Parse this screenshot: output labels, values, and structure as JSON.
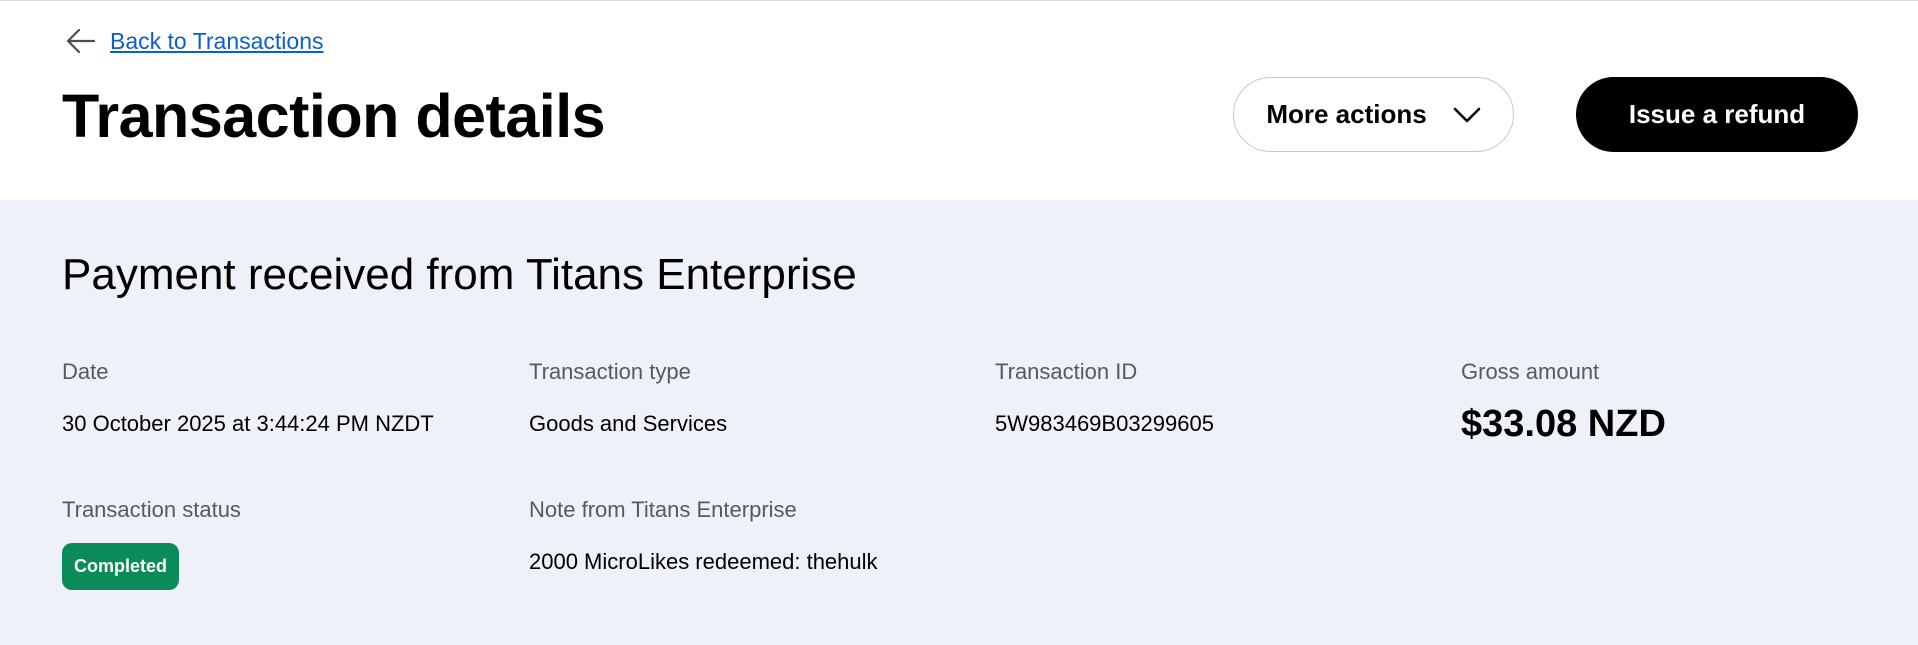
{
  "header": {
    "back_label": "Back to Transactions",
    "title": "Transaction details",
    "more_actions_label": "More actions",
    "refund_label": "Issue a refund"
  },
  "transaction": {
    "heading": "Payment received from Titans Enterprise",
    "date_label": "Date",
    "date_value": "30 October 2025 at 3:44:24 PM NZDT",
    "type_label": "Transaction type",
    "type_value": "Goods and Services",
    "id_label": "Transaction ID",
    "id_value": "5W983469B03299605",
    "gross_label": "Gross amount",
    "gross_value": "$33.08 NZD",
    "status_label": "Transaction status",
    "status_value": "Completed",
    "note_label": "Note from Titans Enterprise",
    "note_value": "2000 MicroLikes redeemed: thehulk"
  },
  "colors": {
    "link": "#0a5fc8",
    "status_completed": "#0b8a5a",
    "panel_bg": "#eef1f8",
    "primary_button": "#000000"
  },
  "icons": {
    "back": "arrow-left-icon",
    "more_actions": "chevron-down-icon"
  }
}
